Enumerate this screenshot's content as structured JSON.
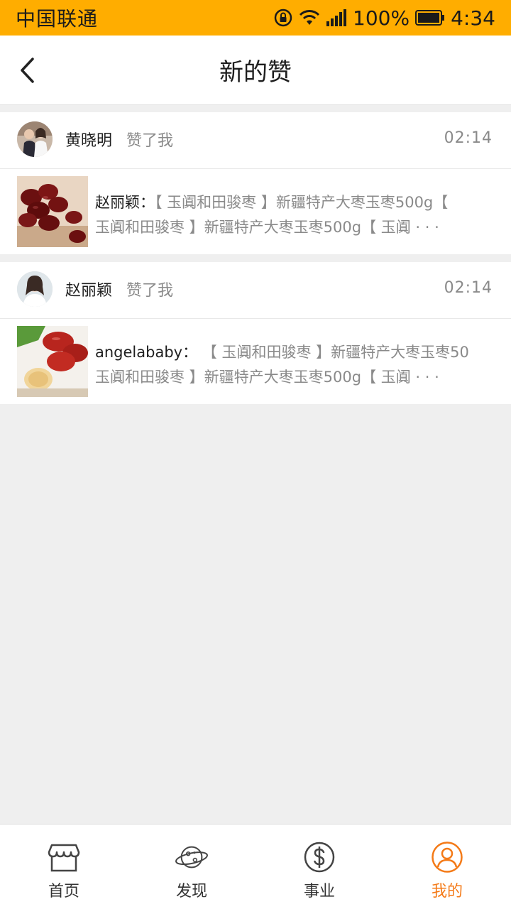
{
  "status_bar": {
    "carrier": "中国联通",
    "battery": "100%",
    "time": "4:34"
  },
  "header": {
    "title": "新的赞",
    "back_icon": "chevron-left-icon"
  },
  "likes": [
    {
      "user": "黄晓明",
      "action": "赞了我",
      "time": "02:14",
      "author": "赵丽颖：",
      "line1": "【 玉阗和田骏枣 】新疆特产大枣玉枣500g【",
      "line2": "玉阗和田骏枣 】新疆特产大枣玉枣500g【 玉阗 · · ·"
    },
    {
      "user": "赵丽颖",
      "action": "赞了我",
      "time": "02:14",
      "author": "angelababy：",
      "line1": " 【 玉阗和田骏枣 】新疆特产大枣玉枣50",
      "line2": "玉阗和田骏枣 】新疆特产大枣玉枣500g【 玉阗 · · ·"
    }
  ],
  "tabbar": {
    "tabs": [
      {
        "label": "首页",
        "icon": "store-icon"
      },
      {
        "label": "发现",
        "icon": "planet-icon"
      },
      {
        "label": "事业",
        "icon": "dollar-icon"
      },
      {
        "label": "我的",
        "icon": "user-icon"
      }
    ],
    "active_color": "#f47a17"
  },
  "colors": {
    "status_bar": "#ffad00",
    "background": "#efefef"
  }
}
